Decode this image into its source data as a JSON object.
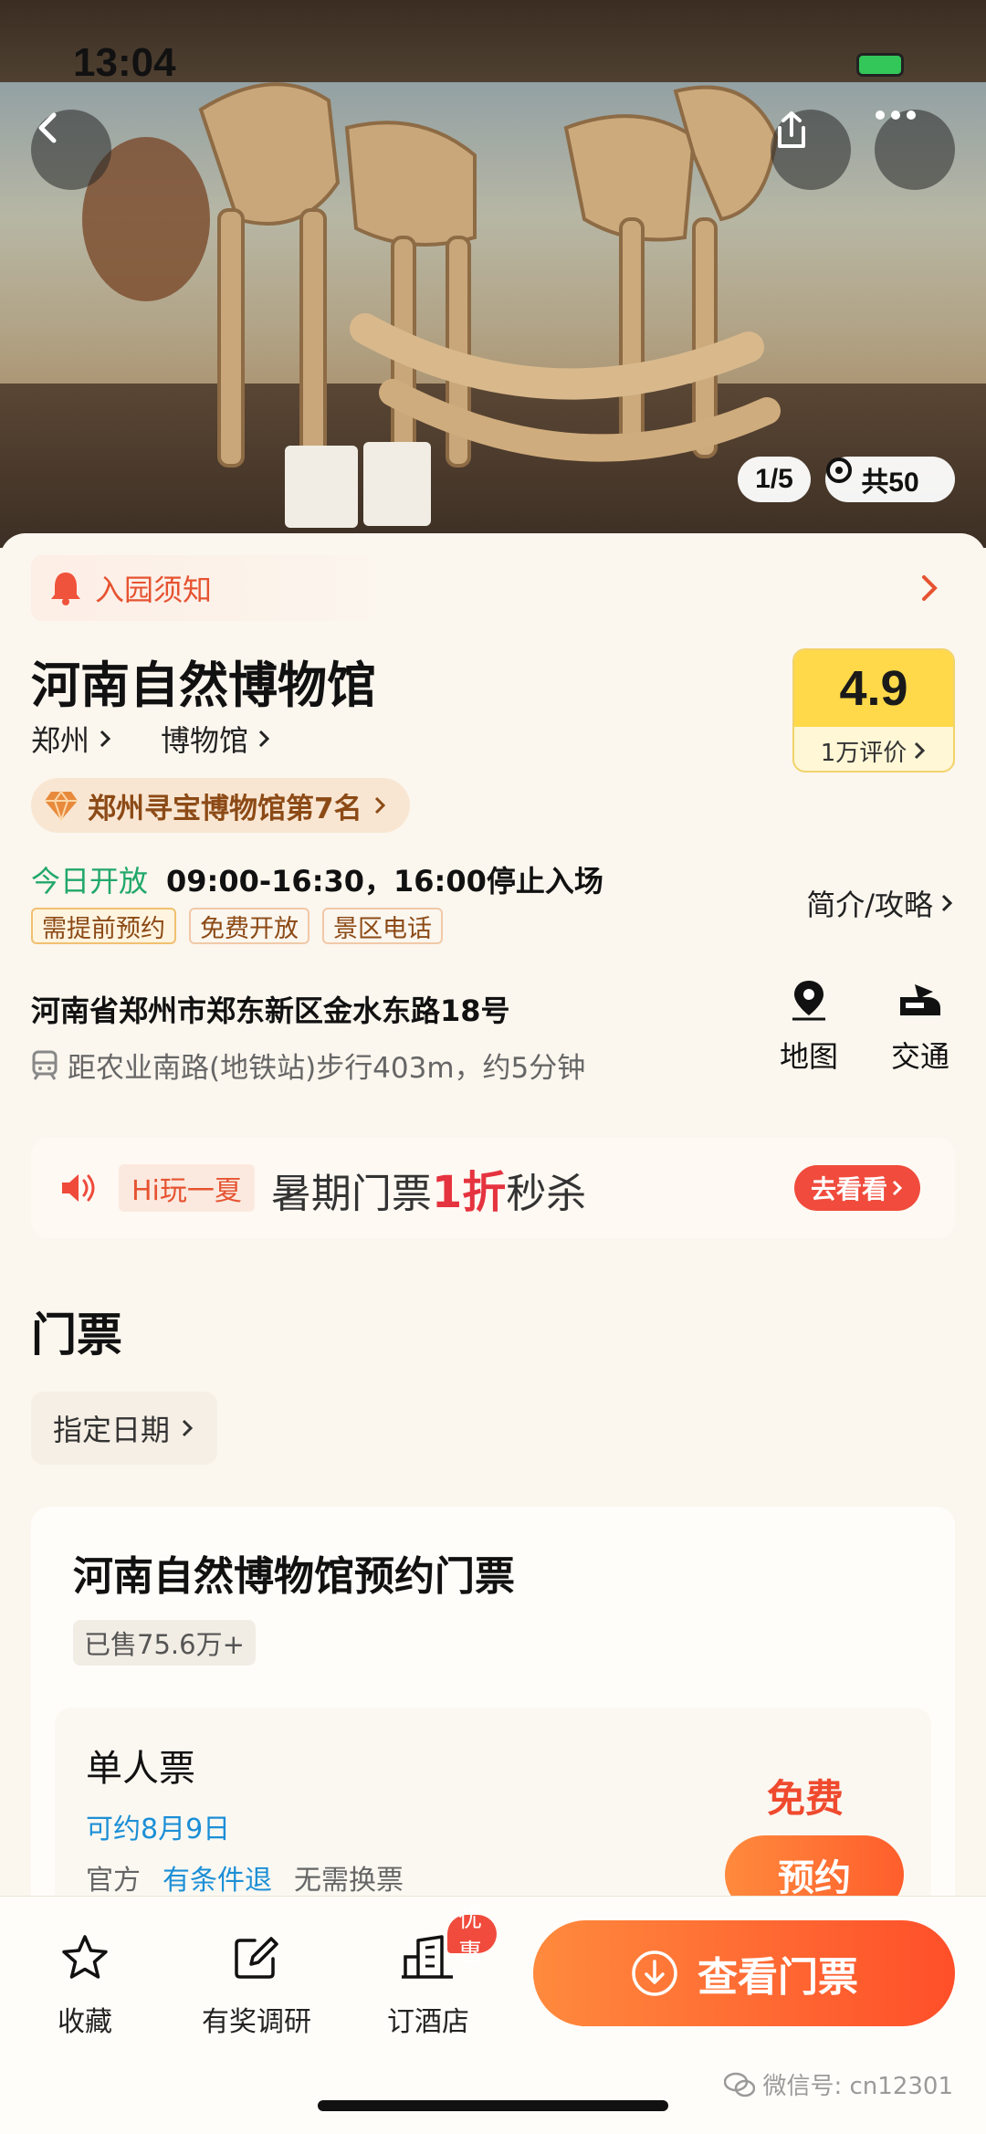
{
  "status": {
    "time": "13:04"
  },
  "hero": {
    "counter": "1/5",
    "album_count": "共50",
    "icons": [
      "back-icon",
      "share-icon",
      "more-icon",
      "camera-icon"
    ]
  },
  "notice": {
    "label": "入园须知"
  },
  "attraction": {
    "name": "河南自然博物馆",
    "city": "郑州",
    "category": "博物馆",
    "rating": "4.9",
    "reviews": "1万评价",
    "rank": "郑州寻宝博物馆第7名"
  },
  "hours": {
    "open_label": "今日开放",
    "time": "09:00-16:30，16:00停止入场",
    "tags": [
      "需提前预约",
      "免费开放",
      "景区电话"
    ],
    "intro_link": "简介/攻略"
  },
  "location": {
    "address": "河南省郑州市郑东新区金水东路18号",
    "metro": "距农业南路(地铁站)步行403m，约5分钟",
    "map_label": "地图",
    "traffic_label": "交通"
  },
  "promo": {
    "hi_tag": "Hi玩一夏",
    "text_before": "暑期门票",
    "highlight": "1折",
    "text_after": "秒杀",
    "button": "去看看"
  },
  "tickets": {
    "section_title": "门票",
    "date_chip": "指定日期",
    "product": {
      "name": "河南自然博物馆预约门票",
      "sold": "已售75.6万+",
      "item": {
        "name": "单人票",
        "available": "可约8月9日",
        "terms": [
          "官方",
          "有条件退",
          "无需换票"
        ],
        "price": "免费",
        "reserve_button": "预约"
      }
    }
  },
  "bottom_bar": {
    "favorite": "收藏",
    "survey": "有奖调研",
    "hotel": "订酒店",
    "hotel_badge": "优惠",
    "cta": "查看门票"
  },
  "watermark": "微信号: cn12301",
  "colors": {
    "accent": "#ff5e2c",
    "rating": "#ffd94a",
    "open_green": "#21a86a",
    "link_blue": "#1c8fd6"
  }
}
